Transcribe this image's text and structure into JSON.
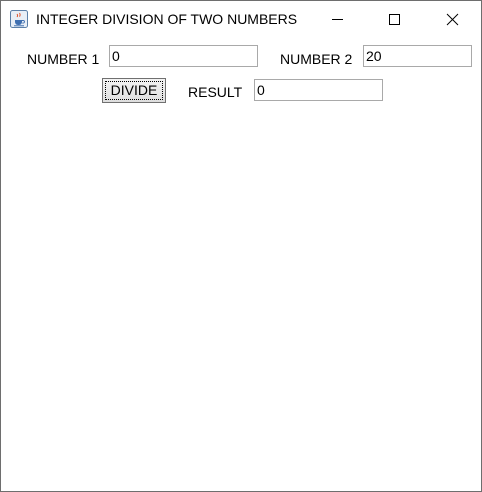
{
  "window": {
    "title": "INTEGER DIVISION OF TWO NUMBERS",
    "app_icon": "java-coffee-cup-icon",
    "controls": {
      "minimize_icon": "minimize-icon",
      "maximize_icon": "maximize-icon",
      "close_icon": "close-icon"
    }
  },
  "form": {
    "number1_label": "NUMBER 1",
    "number1_value": "0",
    "number2_label": "NUMBER 2",
    "number2_value": "20",
    "divide_label": "DIVIDE",
    "result_label": "RESULT",
    "result_value": "0"
  }
}
